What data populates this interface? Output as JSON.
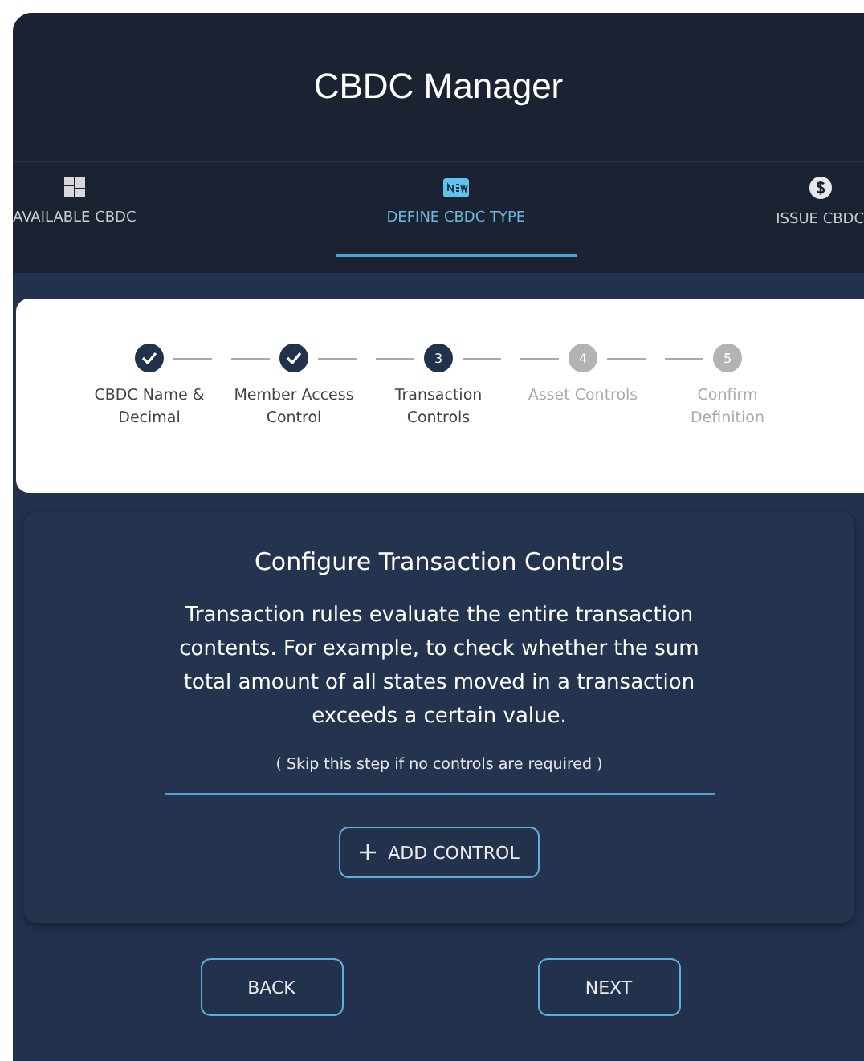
{
  "header": {
    "title": "CBDC Manager"
  },
  "tabs": [
    {
      "label": "AVAILABLE CBDC",
      "selected": false
    },
    {
      "label": "DEFINE CBDC TYPE",
      "selected": true
    },
    {
      "label": "ISSUE CBDC",
      "selected": false
    }
  ],
  "stepper": [
    {
      "label": "CBDC Name & Decimal",
      "completed": true,
      "disabled": false
    },
    {
      "label": "Member Access Control",
      "completed": true,
      "disabled": false
    },
    {
      "number": "3",
      "label": "Transaction Controls",
      "completed": false,
      "disabled": false
    },
    {
      "number": "4",
      "label": "Asset Controls",
      "completed": false,
      "disabled": true
    },
    {
      "number": "5",
      "label": "Confirm Definition",
      "completed": false,
      "disabled": true
    }
  ],
  "card": {
    "title": "Configure Transaction Controls",
    "description": "Transaction rules evaluate the entire transaction contents. For example, to check whether the sum total amount of all states moved in a transaction exceeds a certain value.",
    "note": "( Skip this step if no controls are required )",
    "button": "ADD CONTROL"
  },
  "buttons": [
    "BACK",
    "NEXT"
  ]
}
